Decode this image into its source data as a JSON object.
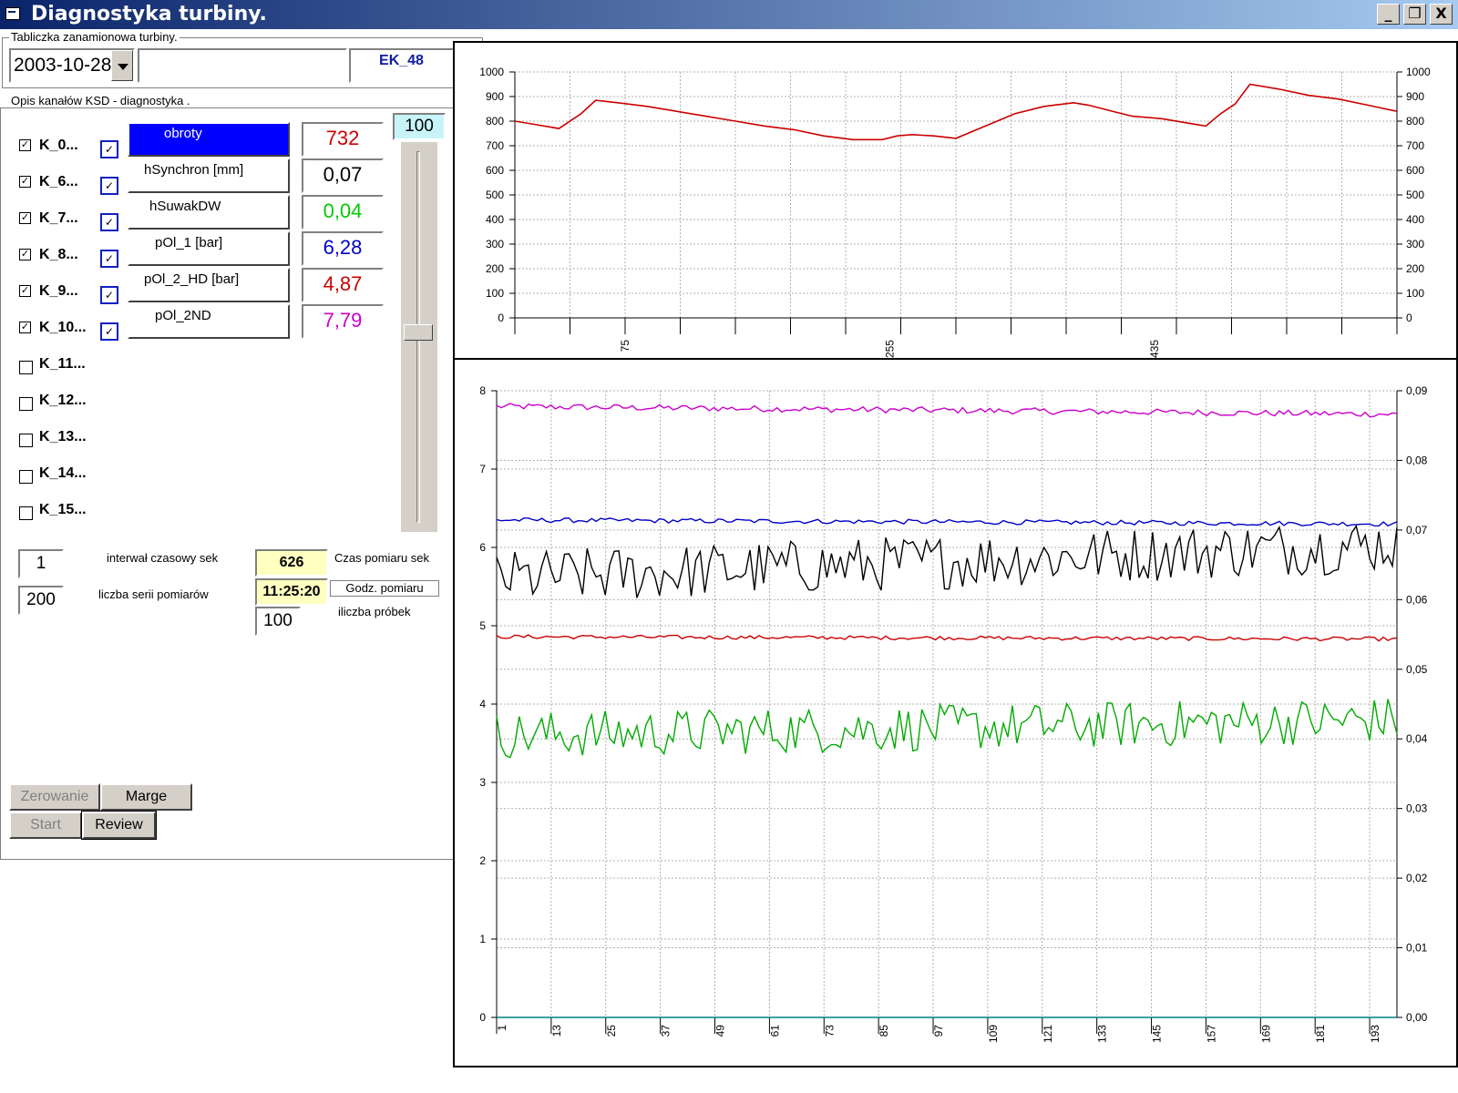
{
  "window": {
    "title": "Diagnostyka turbiny.",
    "min_label": "_",
    "restore_label": "❐",
    "close_label": "X"
  },
  "nameplate": {
    "label": "Tabliczka zanamionowa turbiny.",
    "date": "2003-10-28",
    "code": "EK_48"
  },
  "channels": {
    "label": "Opis kanałów  KSD - diagnostyka .",
    "items": [
      {
        "name": "K_0...",
        "checked": true
      },
      {
        "name": "K_6...",
        "checked": true
      },
      {
        "name": "K_7...",
        "checked": true
      },
      {
        "name": "K_8...",
        "checked": true
      },
      {
        "name": "K_9...",
        "checked": true
      },
      {
        "name": "K_10...",
        "checked": true
      },
      {
        "name": "K_11...",
        "checked": false
      },
      {
        "name": "K_12...",
        "checked": false
      },
      {
        "name": "K_13...",
        "checked": false
      },
      {
        "name": "K_14...",
        "checked": false
      },
      {
        "name": "K_15...",
        "checked": false
      }
    ],
    "signals": [
      {
        "label": "obroty",
        "value": "732",
        "color": "#cc0000"
      },
      {
        "label": "hSynchron    [mm]",
        "value": "0,07",
        "color": "#000000"
      },
      {
        "label": "hSuwakDW",
        "value": "0,04",
        "color": "#00cc00"
      },
      {
        "label": "pOl_1    [bar]",
        "value": "6,28",
        "color": "#0000cc"
      },
      {
        "label": "pOl_2_HD    [bar]",
        "value": "4,87",
        "color": "#cc0000"
      },
      {
        "label": "pOl_2ND",
        "value": "7,79",
        "color": "#cc00cc"
      }
    ],
    "slider_max": "100"
  },
  "settings": {
    "interval_value": "1",
    "interval_label": "interwał czasowy sek",
    "series_value": "200",
    "series_label": "liczba serii pomiarów",
    "time_value": "626",
    "time_label": "Czas pomiaru sek",
    "clock_value": "11:25:20",
    "clock_label": "Godz. pomiaru",
    "samples_value": "100",
    "samples_label": "iliczba próbek"
  },
  "buttons": {
    "zero": "Zerowanie",
    "marge": "Marge",
    "start": "Start",
    "review": "Review"
  },
  "chart_data": [
    {
      "type": "line",
      "ylim": [
        0,
        1000
      ],
      "y_ticks": [
        "0",
        "100",
        "200",
        "300",
        "400",
        "500",
        "600",
        "700",
        "800",
        "900",
        "1000"
      ],
      "x_ticks": [
        "75",
        "255",
        "435"
      ],
      "series": [
        {
          "color": "#cc0000",
          "x": [
            0,
            15,
            30,
            45,
            55,
            70,
            90,
            110,
            130,
            150,
            170,
            190,
            210,
            230,
            250,
            260,
            270,
            285,
            300,
            320,
            340,
            360,
            380,
            390,
            400,
            410,
            420,
            440,
            460,
            470,
            480,
            490,
            500,
            520,
            540,
            560,
            580,
            600
          ],
          "y": [
            800,
            785,
            770,
            830,
            885,
            875,
            860,
            840,
            820,
            800,
            780,
            765,
            740,
            725,
            725,
            740,
            745,
            740,
            730,
            780,
            830,
            860,
            875,
            865,
            850,
            835,
            820,
            810,
            790,
            780,
            830,
            870,
            950,
            930,
            905,
            890,
            865,
            840
          ]
        }
      ]
    },
    {
      "type": "line",
      "ylim_left": [
        0,
        8
      ],
      "ylim_right": [
        0,
        0.09
      ],
      "y_ticks_left": [
        "0",
        "1",
        "2",
        "3",
        "4",
        "5",
        "6",
        "7",
        "8"
      ],
      "y_ticks_right": [
        "0,00",
        "0,01",
        "0,02",
        "0,03",
        "0,04",
        "0,05",
        "0,06",
        "0,07",
        "0,08",
        "0,09"
      ],
      "x_ticks": [
        "1",
        "13",
        "25",
        "37",
        "49",
        "61",
        "73",
        "85",
        "97",
        "109",
        "121",
        "133",
        "145",
        "157",
        "169",
        "181",
        "193"
      ],
      "series": [
        {
          "color": "#cc00cc",
          "axis": "left",
          "base": 7.8,
          "noise": 0.04,
          "trend": -0.1
        },
        {
          "color": "#0000cc",
          "axis": "left",
          "base": 6.35,
          "noise": 0.03,
          "trend": -0.05
        },
        {
          "color": "#cc0000",
          "axis": "left",
          "base": 4.86,
          "noise": 0.025,
          "trend": -0.03
        },
        {
          "color": "#000000",
          "axis": "right",
          "base": 0.063,
          "noise": 0.004,
          "trend": 0.005
        },
        {
          "color": "#00aa00",
          "axis": "left",
          "base": 3.6,
          "noise": 0.3,
          "trend": 0.2
        },
        {
          "color": "#008080",
          "axis": "left",
          "base": 0.0,
          "noise": 0.0,
          "trend": 0.0
        }
      ]
    }
  ]
}
